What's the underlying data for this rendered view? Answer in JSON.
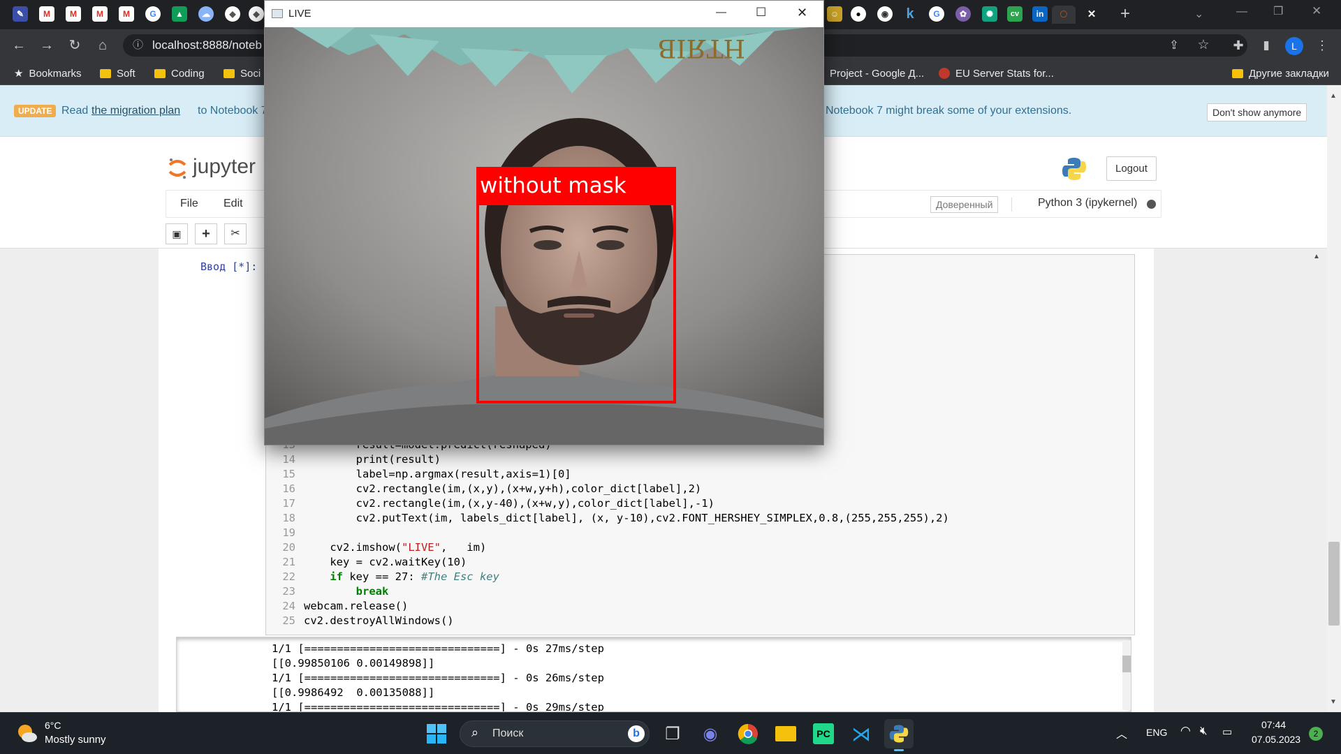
{
  "browser": {
    "url": "localhost:8888/noteb",
    "tab_close": "✕",
    "new_tab": "+",
    "bookmarks": [
      {
        "label": "Bookmarks",
        "icon": "star-icon"
      },
      {
        "label": "Soft",
        "icon": "folder-icon"
      },
      {
        "label": "Coding",
        "icon": "folder-icon"
      },
      {
        "label": "Soci",
        "icon": "folder-icon"
      },
      {
        "label": "Project - Google Д...",
        "icon": "google-drive-icon"
      },
      {
        "label": "EU Server Stats for...",
        "icon": "game-icon"
      },
      {
        "label": "Другие закладки",
        "icon": "folder-icon"
      }
    ],
    "profile_initial": "L"
  },
  "notice": {
    "badge": "UPDATE",
    "text_before": "Read",
    "link": "the migration plan",
    "text_after": "to Notebook 7 to",
    "text_right": "Notebook 7 might break some of your extensions.",
    "dismiss": "Don't show anymore"
  },
  "jupyter": {
    "logo_text": "jupyter",
    "logout": "Logout",
    "menu_file": "File",
    "menu_edit": "Edit",
    "trusted": "Доверенный",
    "kernel": "Python 3 (ipykernel)",
    "prompt": "Ввод [*]:"
  },
  "code_lines": [
    {
      "n": "13",
      "text": "        result=model.predict(reshaped)"
    },
    {
      "n": "14",
      "text": "        print(result)"
    },
    {
      "n": "15",
      "text": "        label=np.argmax(result,axis=1)[0]"
    },
    {
      "n": "16",
      "text": "        cv2.rectangle(im,(x,y),(x+w,y+h),color_dict[label],2)"
    },
    {
      "n": "17",
      "text": "        cv2.rectangle(im,(x,y-40),(x+w,y),color_dict[label],-1)"
    },
    {
      "n": "18",
      "text": "        cv2.putText(im, labels_dict[label], (x, y-10),cv2.FONT_HERSHEY_SIMPLEX,0.8,(255,255,255),2)"
    },
    {
      "n": "19",
      "text": ""
    },
    {
      "n": "20",
      "text": "    cv2.imshow(\"LIVE\",   im)"
    },
    {
      "n": "21",
      "text": "    key = cv2.waitKey(10)"
    },
    {
      "n": "22",
      "text": "    if key == 27: #The Esc key"
    },
    {
      "n": "23",
      "text": "        break"
    },
    {
      "n": "24",
      "text": "webcam.release()"
    },
    {
      "n": "25",
      "text": "cv2.destroyAllWindows()"
    }
  ],
  "output_lines": [
    "1/1 [==============================] - 0s 27ms/step",
    "[[0.99850106 0.00149898]]",
    "1/1 [==============================] - 0s 26ms/step",
    "[[0.9986492  0.00135088]]",
    "1/1 [==============================] - 0s 29ms/step"
  ],
  "live_window": {
    "title": "LIVE",
    "minimize": "—",
    "maximize": "☐",
    "close": "✕",
    "banner": "HTЯIB",
    "detection_label": "without mask",
    "box_color": "#ff0000"
  },
  "taskbar": {
    "temp": "6°C",
    "weather": "Mostly sunny",
    "search": "Поиск",
    "lang": "ENG",
    "time": "07:44",
    "date": "07.05.2023",
    "notif": "2"
  }
}
